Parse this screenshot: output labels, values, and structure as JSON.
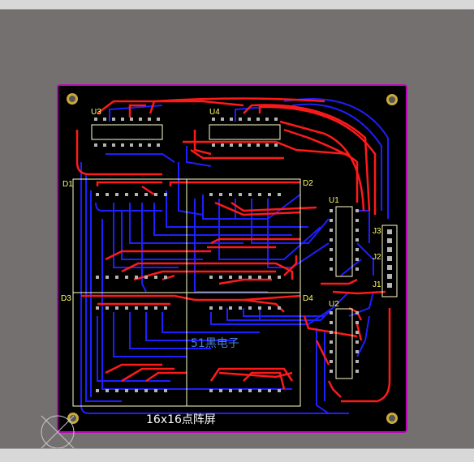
{
  "board": {
    "title": "16x16点阵屏",
    "center_label": "51黑电子",
    "colors": {
      "background": "#747070",
      "board": "#000000",
      "outline": "#c000c0",
      "top_trace": "#ff1a1a",
      "bottom_trace": "#1e1eff",
      "silkscreen": "#ffffcc",
      "label": "#ffff66",
      "mount_hole": "#c8aa3c"
    }
  },
  "designators": {
    "u3": "U3",
    "u4": "U4",
    "u1": "U1",
    "u2": "U2",
    "d1": "D1",
    "d2": "D2",
    "d3": "D3",
    "d4": "D4",
    "j1": "J1",
    "j2": "J2",
    "j3": "J3"
  }
}
